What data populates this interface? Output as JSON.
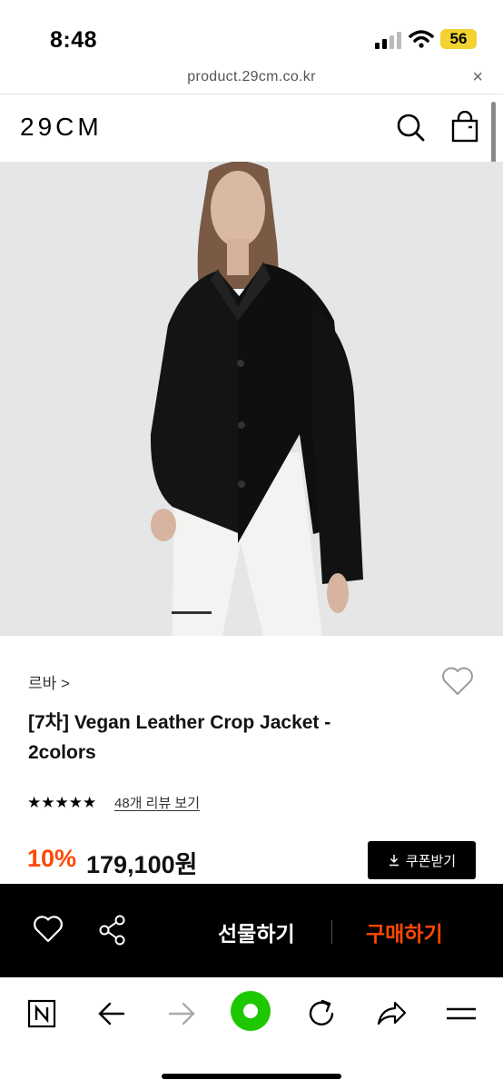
{
  "status": {
    "time": "8:48",
    "battery": "56"
  },
  "browser": {
    "url": "product.29cm.co.kr",
    "close": "×"
  },
  "site": {
    "logo": "29CM"
  },
  "product": {
    "brand": "르바 >",
    "title": "[7차] Vegan Leather Crop Jacket - 2colors",
    "rating_stars": "★★★★★",
    "reviews_link": "48개 리뷰 보기",
    "discount": "10%",
    "price": "179,100원",
    "coupon_button": "쿠폰받기"
  },
  "buybar": {
    "gift": "선물하기",
    "buy": "구매하기"
  },
  "colors": {
    "accent": "#ff4800",
    "brand_green": "#1ec800"
  },
  "icons": [
    "signal-icon",
    "wifi-icon",
    "search-icon",
    "bag-icon",
    "heart-icon",
    "share-icon",
    "download-icon",
    "naver-n-icon",
    "back-arrow-icon",
    "forward-arrow-icon",
    "green-dot-icon",
    "reload-icon",
    "share-arrow-icon",
    "menu-icon"
  ]
}
